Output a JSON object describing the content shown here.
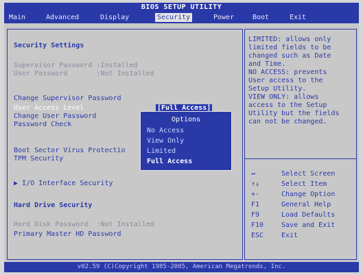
{
  "title": "BIOS SETUP UTILITY",
  "menu": [
    {
      "label": "Main"
    },
    {
      "label": "Advanced"
    },
    {
      "label": "Display"
    },
    {
      "label": "Security"
    },
    {
      "label": "Power"
    },
    {
      "label": "Boot"
    },
    {
      "label": "Exit"
    }
  ],
  "left": {
    "section_security": "Security Settings",
    "supervisor_password": "Supervisor Password :Installed",
    "user_password": "User Password       :Not Installed",
    "change_supervisor": "Change Supervisor Password",
    "user_access_level": "User Access Level",
    "user_access_value": "[Full Access]",
    "change_user": "Change User Password",
    "password_check": "Password Check",
    "boot_sector": "Boot Sector Virus Protectio",
    "tpm": "TPM Security",
    "io_interface": "▶ I/O Interface Security",
    "section_hdd": "Hard Drive Security",
    "hard_disk_password": "Hard Disk Password  :Not Installed",
    "primary_master": "Primary Master HD Password"
  },
  "popup": {
    "title": "Options",
    "options": [
      "No Access",
      "View Only",
      "Limited",
      "Full Access"
    ]
  },
  "help": {
    "lines": [
      "LIMITED: allows only",
      "limited fields to be",
      "changed such as Date",
      "and Time.",
      "NO ACCESS: prevents",
      "User access to the",
      "Setup Utility.",
      "VIEW ONLY: allows",
      "access to the Setup",
      "Utility but the fields",
      "can not be changed."
    ]
  },
  "keys": [
    {
      "key": "↔",
      "desc": "Select Screen"
    },
    {
      "key": "↑↓",
      "desc": "Select Item"
    },
    {
      "key": "+-",
      "desc": "Change Option"
    },
    {
      "key": "F1",
      "desc": "General Help"
    },
    {
      "key": "F9",
      "desc": "Load Defaults"
    },
    {
      "key": "F10",
      "desc": "Save and Exit"
    },
    {
      "key": "ESC",
      "desc": "Exit"
    }
  ],
  "footer": "v02.59 (C)Copyright 1985-2005, American Megatrends, Inc."
}
